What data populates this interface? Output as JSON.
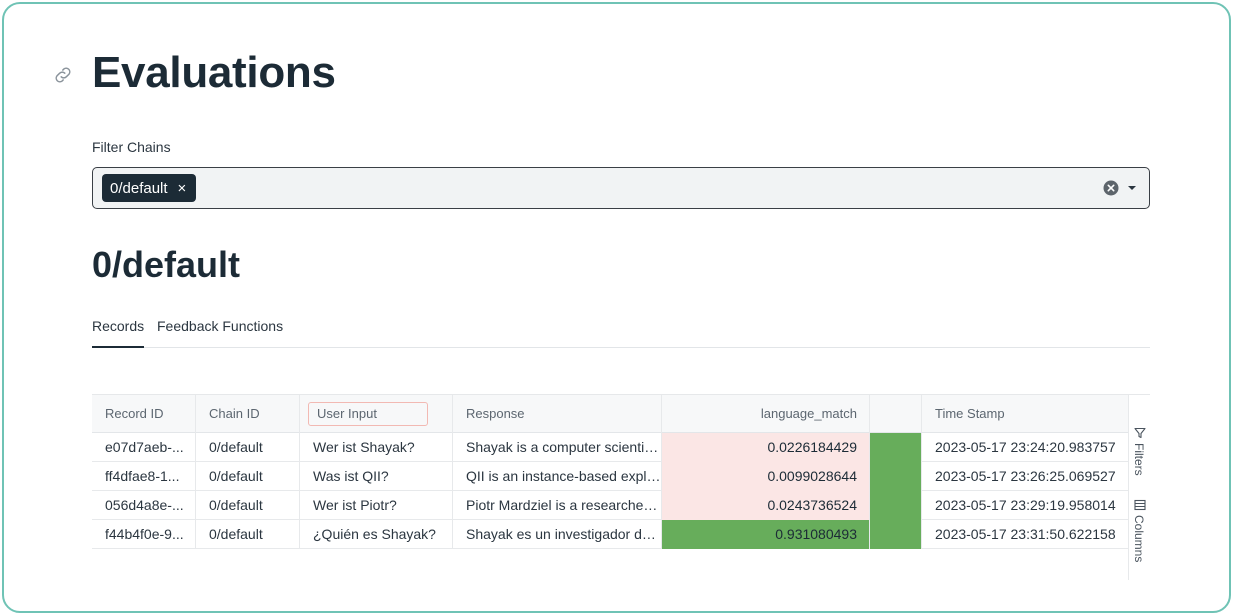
{
  "page": {
    "title": "Evaluations"
  },
  "filter": {
    "label": "Filter Chains",
    "chips": [
      {
        "label": "0/default",
        "remove": "×"
      }
    ]
  },
  "section": {
    "title": "0/default"
  },
  "tabs": [
    {
      "label": "Records",
      "active": true
    },
    {
      "label": "Feedback Functions",
      "active": false
    }
  ],
  "table": {
    "columns": [
      "Record ID",
      "Chain ID",
      "User Input",
      "Response",
      "language_match",
      "",
      "Time Stamp"
    ],
    "rows": [
      {
        "record_id": "e07d7aeb-...",
        "chain_id": "0/default",
        "user_input": "Wer ist Shayak?",
        "response": "Shayak is a computer scienti…",
        "language_match": "0.0226184429",
        "time_stamp": "2023-05-17 23:24:20.983757",
        "score": 0.0226184429
      },
      {
        "record_id": "ff4dfae8-1...",
        "chain_id": "0/default",
        "user_input": "Was ist QII?",
        "response": "QII is an instance-based expl…",
        "language_match": "0.0099028644",
        "time_stamp": "2023-05-17 23:26:25.069527",
        "score": 0.0099028644
      },
      {
        "record_id": "056d4a8e-...",
        "chain_id": "0/default",
        "user_input": "Wer ist Piotr?",
        "response": "Piotr Mardziel is a researche…",
        "language_match": "0.0243736524",
        "time_stamp": "2023-05-17 23:29:19.958014",
        "score": 0.0243736524
      },
      {
        "record_id": "f44b4f0e-9...",
        "chain_id": "0/default",
        "user_input": "¿Quién es Shayak?",
        "response": "Shayak es un investigador d…",
        "language_match": "0.931080493",
        "time_stamp": "2023-05-17 23:31:50.622158",
        "score": 0.931080493
      }
    ],
    "side_rail": {
      "filters": "Filters",
      "columns": "Columns"
    }
  },
  "colors": {
    "accent_dark": "#1c2b36",
    "frame_border": "#6fc3b5",
    "low_score_bg": "#fbe6e5",
    "high_score_bg": "#67ad5b",
    "bar_green": "#67ad5b"
  }
}
